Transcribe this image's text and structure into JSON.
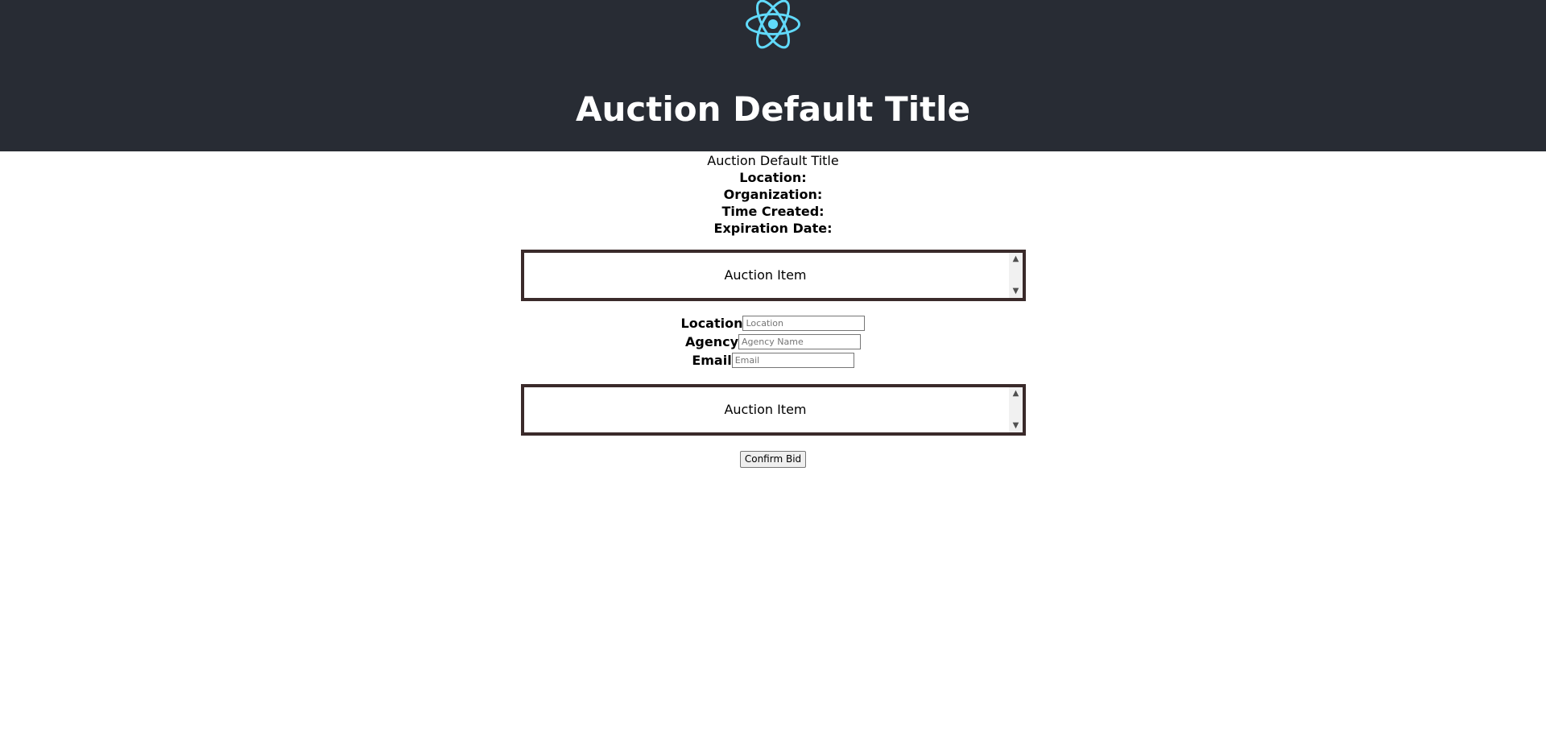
{
  "header": {
    "logo_icon": "react-logo-icon",
    "logo_color": "#61dafb",
    "background_color": "#282c34",
    "title": "Auction Default Title"
  },
  "auction_info": {
    "title": "Auction Default Title",
    "location_label": "Location:",
    "organization_label": "Organization:",
    "time_created_label": "Time Created:",
    "expiration_date_label": "Expiration Date:"
  },
  "auction_items": [
    {
      "label": "Auction Item"
    },
    {
      "label": "Auction Item"
    }
  ],
  "bid_form": {
    "location_label": "Location",
    "location_placeholder": "Location",
    "location_value": "",
    "agency_label": "Agency",
    "agency_placeholder": "Agency Name",
    "agency_value": "",
    "email_label": "Email",
    "email_placeholder": "Email",
    "email_value": ""
  },
  "actions": {
    "confirm_bid_label": "Confirm Bid"
  },
  "scroll_icons": {
    "up": "chevron-up-icon",
    "down": "chevron-down-icon"
  }
}
